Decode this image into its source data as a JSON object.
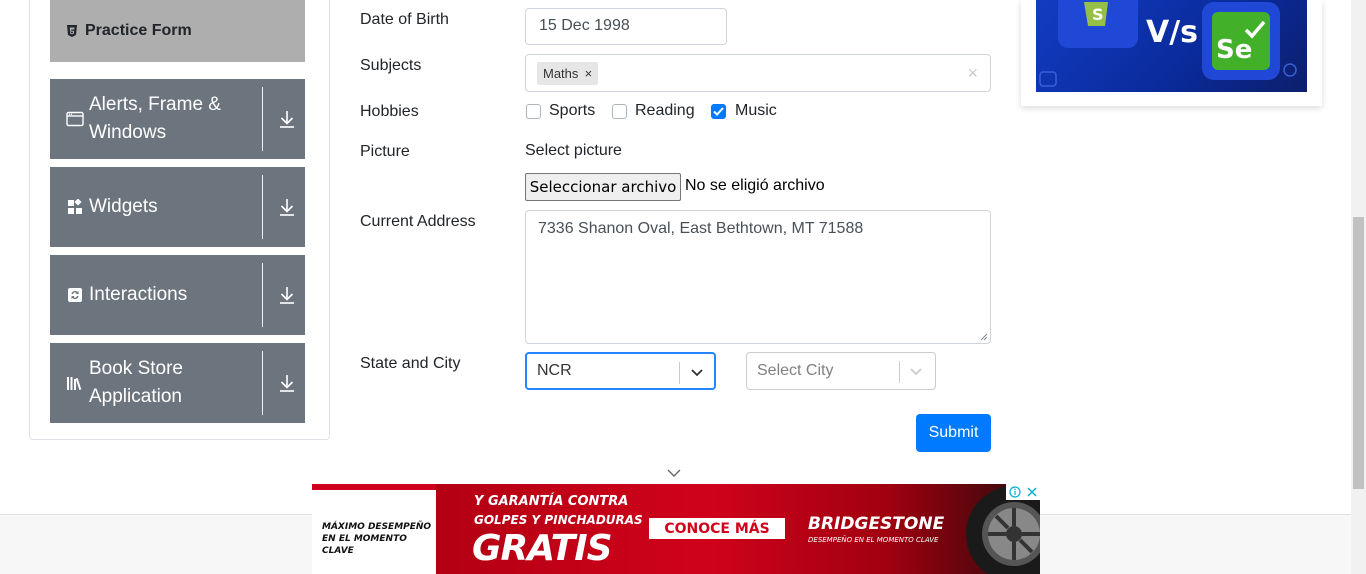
{
  "sidebar": {
    "practice_form": "Practice Form",
    "groups": [
      {
        "label": "Alerts, Frame & Windows",
        "icon": "window-icon"
      },
      {
        "label": "Widgets",
        "icon": "widgets-icon"
      },
      {
        "label": "Interactions",
        "icon": "interactions-icon"
      },
      {
        "label": "Book Store Application",
        "icon": "books-icon"
      }
    ]
  },
  "form": {
    "dob_label": "Date of Birth",
    "dob_value": "15 Dec 1998",
    "subjects_label": "Subjects",
    "subject_chip": "Maths",
    "hobbies_label": "Hobbies",
    "hobbies": [
      {
        "label": "Sports",
        "checked": false
      },
      {
        "label": "Reading",
        "checked": false
      },
      {
        "label": "Music",
        "checked": true
      }
    ],
    "picture_label": "Picture",
    "select_picture": "Select picture",
    "file_button": "Seleccionar archivo",
    "file_status": "No se eligió archivo",
    "address_label": "Current Address",
    "address_value": "7336 Shanon Oval, East Bethtown, MT 71588",
    "state_city_label": "State and City",
    "state_value": "NCR",
    "city_placeholder": "Select City",
    "submit": "Submit"
  },
  "ad_bottom": {
    "left_text_1": "MÁXIMO DESEMPEÑO",
    "left_text_2": "EN EL MOMENTO CLAVE",
    "line1": "Y GARANTÍA CONTRA",
    "line2": "GOLPES Y PINCHADURAS",
    "headline": "GRATIS",
    "cta": "CONOCE MÁS",
    "brand": "BRIDGESTONE",
    "tagline": "DESEMPEÑO EN EL MOMENTO CLAVE"
  },
  "ad_right": {
    "vs": "V/s",
    "se": "Se"
  },
  "colors": {
    "primary": "#007bff",
    "nav_group": "#6c757d",
    "nav_active": "#aeaeae",
    "focus": "#2684ff",
    "ad_red": "#d0021b"
  }
}
